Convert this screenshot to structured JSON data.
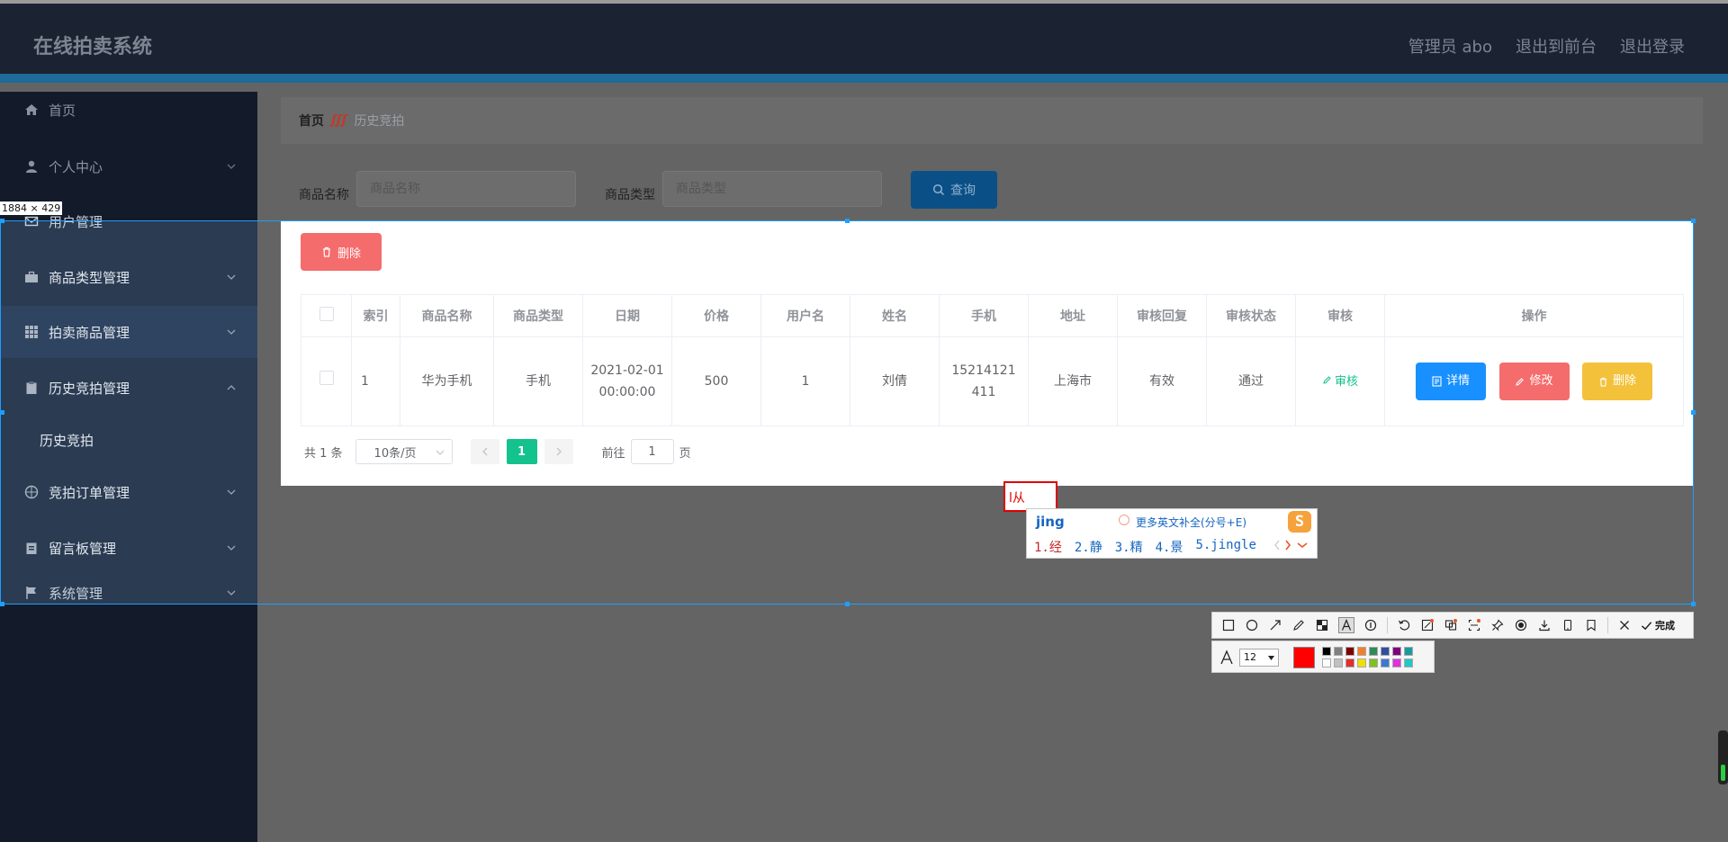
{
  "header": {
    "brand": "在线拍卖系统",
    "admin": "管理员 abo",
    "to_front": "退出到前台",
    "logout": "退出登录"
  },
  "sidebar": {
    "items": [
      {
        "label": "首页",
        "icon": "home-icon"
      },
      {
        "label": "个人中心",
        "icon": "user-icon"
      },
      {
        "label": "用户管理",
        "icon": "mail-icon"
      },
      {
        "label": "商品类型管理",
        "icon": "briefcase-icon"
      },
      {
        "label": "拍卖商品管理",
        "icon": "grid-icon"
      },
      {
        "label": "历史竞拍管理",
        "icon": "clipboard-icon"
      },
      {
        "label": "历史竞拍",
        "icon": ""
      },
      {
        "label": "竞拍订单管理",
        "icon": "compass-icon"
      },
      {
        "label": "留言板管理",
        "icon": "note-icon"
      },
      {
        "label": "系统管理",
        "icon": "flag-icon"
      }
    ]
  },
  "breadcrumb": {
    "home": "首页",
    "separator": "ʃʃʃ",
    "current": "历史竞拍"
  },
  "search": {
    "name_label": "商品名称",
    "name_placeholder": "商品名称",
    "type_label": "商品类型",
    "type_placeholder": "商品类型",
    "query_label": "查询"
  },
  "toolbar": {
    "delete_label": "删除"
  },
  "table": {
    "headers": [
      "索引",
      "商品名称",
      "商品类型",
      "日期",
      "价格",
      "用户名",
      "姓名",
      "手机",
      "地址",
      "审核回复",
      "审核状态",
      "审核",
      "操作"
    ],
    "row": {
      "index": "1",
      "name": "华为手机",
      "type": "手机",
      "date": "2021-02-01 00:00:00",
      "price": "500",
      "username": "1",
      "realname": "刘倩",
      "phone": "15214121411",
      "address": "上海市",
      "reply": "有效",
      "status": "通过",
      "audit": "审核",
      "detail": "详情",
      "edit": "修改",
      "delete": "删除"
    }
  },
  "pagination": {
    "total": "共 1 条",
    "page_size": "10条/页",
    "current": "1",
    "goto_prefix": "前往",
    "goto_value": "1",
    "goto_suffix": "页"
  },
  "screenshot_tool": {
    "dimensions": "1884 × 429",
    "text_box": "l从",
    "font_size": "12",
    "done_label": "完成",
    "current_color": "#ff0000",
    "palette": [
      "#000000",
      "#808080",
      "#800000",
      "#f08030",
      "#2e8b57",
      "#2f4fa0",
      "#800080",
      "#1a9a9a",
      "#ffffff",
      "#c0c0c0",
      "#e03030",
      "#f0e000",
      "#80c020",
      "#3a7ad0",
      "#e030e0",
      "#20c8c8"
    ]
  },
  "ime": {
    "pinyin": "jing",
    "hint": "更多英文补全(分号+E)",
    "candidates": [
      "1.经",
      "2.静",
      "3.精",
      "4.景",
      "5.jingle"
    ],
    "logo": "S"
  },
  "colors": {
    "accent": "#13c28d",
    "danger": "#f56c6c",
    "primary": "#1890ff",
    "warning": "#f3c13a"
  }
}
